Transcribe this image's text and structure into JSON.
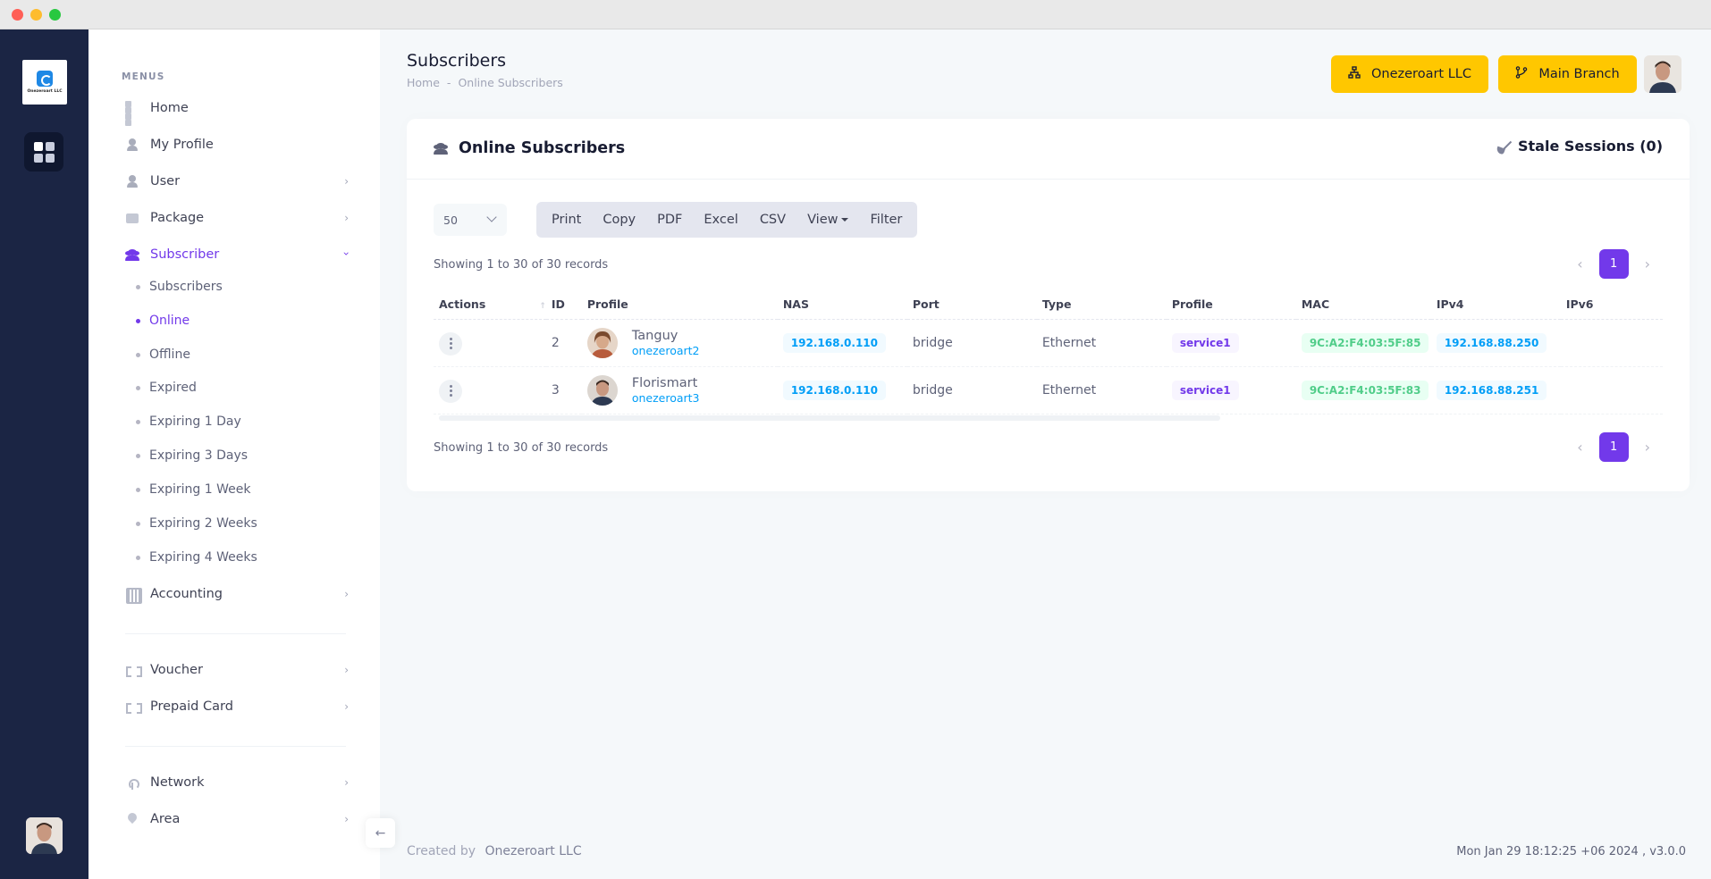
{
  "brand": {
    "logo_text": "Onezeroart LLC"
  },
  "sidebar": {
    "menus_title": "MENUS",
    "items": [
      {
        "label": "Home"
      },
      {
        "label": "My Profile"
      },
      {
        "label": "User"
      },
      {
        "label": "Package"
      },
      {
        "label": "Subscriber"
      },
      {
        "label": "Accounting"
      },
      {
        "label": "Voucher"
      },
      {
        "label": "Prepaid Card"
      },
      {
        "label": "Network"
      },
      {
        "label": "Area"
      }
    ],
    "subscriber_sub": [
      {
        "label": "Subscribers"
      },
      {
        "label": "Online"
      },
      {
        "label": "Offline"
      },
      {
        "label": "Expired"
      },
      {
        "label": "Expiring 1 Day"
      },
      {
        "label": "Expiring 3 Days"
      },
      {
        "label": "Expiring 1 Week"
      },
      {
        "label": "Expiring 2 Weeks"
      },
      {
        "label": "Expiring 4 Weeks"
      }
    ],
    "active_item": "Subscriber",
    "active_sub": "Online"
  },
  "header": {
    "title": "Subscribers",
    "breadcrumb": [
      "Home",
      "-",
      "Online Subscribers"
    ],
    "company_button": "Onezeroart LLC",
    "branch_button": "Main Branch"
  },
  "card": {
    "title": "Online Subscribers",
    "stale_sessions": "Stale Sessions (0)",
    "page_length": "50",
    "tools": [
      "Print",
      "Copy",
      "PDF",
      "Excel",
      "CSV",
      "View",
      "Filter"
    ],
    "info_top": "Showing 1 to 30 of 30 records",
    "info_bottom": "Showing 1 to 30 of 30 records",
    "current_page": "1"
  },
  "table": {
    "columns": [
      "Actions",
      "ID",
      "Profile",
      "NAS",
      "Port",
      "Type",
      "Profile",
      "MAC",
      "IPv4",
      "IPv6"
    ],
    "rows": [
      {
        "id": "2",
        "name": "Tanguy",
        "username": "onezeroart2",
        "nas": "192.168.0.110",
        "port": "bridge",
        "type": "Ethernet",
        "profile": "service1",
        "mac": "9C:A2:F4:03:5F:85",
        "ipv4": "192.168.88.250",
        "ipv6": ""
      },
      {
        "id": "3",
        "name": "Florismart",
        "username": "onezeroart3",
        "nas": "192.168.0.110",
        "port": "bridge",
        "type": "Ethernet",
        "profile": "service1",
        "mac": "9C:A2:F4:03:5F:83",
        "ipv4": "192.168.88.251",
        "ipv6": ""
      }
    ]
  },
  "footer": {
    "created_by": "Created by",
    "company": "Onezeroart LLC",
    "right": "Mon Jan 29 18:12:25 +06 2024 ,   v3.0.0"
  },
  "colors": {
    "accent": "#7239ea",
    "yellow": "#ffc700",
    "aside": "#1b2544",
    "link": "#009ef7",
    "success": "#50cd89"
  },
  "icons": {
    "home": "grid-icon",
    "profile": "user-icon",
    "package": "box-icon",
    "subscriber": "users-icon",
    "accounting": "calculator-icon",
    "voucher": "ticket-icon",
    "network": "antenna-icon",
    "area": "map-pin-icon",
    "company": "sitemap-icon",
    "branch": "git-branch-icon",
    "stale": "broom-icon"
  }
}
